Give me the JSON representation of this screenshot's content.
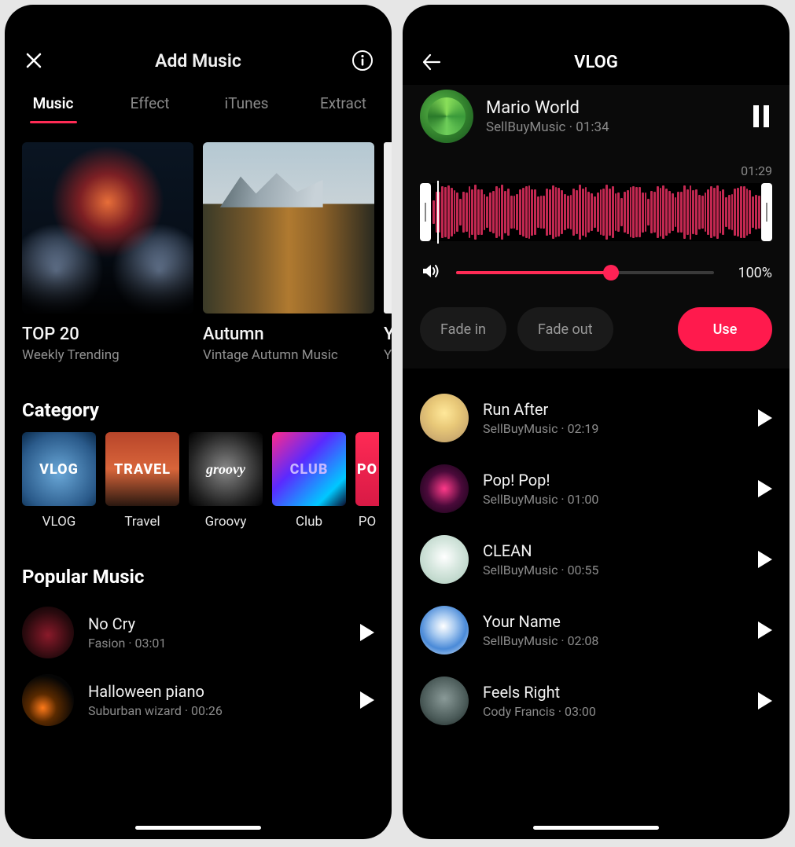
{
  "left": {
    "header": {
      "title": "Add Music"
    },
    "tabs": [
      "Music",
      "Effect",
      "iTunes",
      "Extract"
    ],
    "active_tab": 0,
    "hero": [
      {
        "title": "TOP 20",
        "subtitle": "Weekly Trending"
      },
      {
        "title": "Autumn",
        "subtitle": "Vintage Autumn Music"
      },
      {
        "title": "Y",
        "subtitle": "Y"
      }
    ],
    "category_heading": "Category",
    "categories": [
      {
        "tile": "VLOG",
        "label": "VLOG"
      },
      {
        "tile": "TRAVEL",
        "label": "Travel"
      },
      {
        "tile": "groovy",
        "label": "Groovy"
      },
      {
        "tile": "CLUB",
        "label": "Club"
      },
      {
        "tile": "PO",
        "label": "PO"
      }
    ],
    "popular_heading": "Popular Music",
    "popular": [
      {
        "title": "No Cry",
        "artist": "Fasion",
        "duration": "03:01"
      },
      {
        "title": "Halloween piano",
        "artist": "Suburban wizard",
        "duration": "00:26"
      }
    ]
  },
  "right": {
    "header": {
      "title": "VLOG"
    },
    "now_playing": {
      "title": "Mario World",
      "artist": "SellBuyMusic",
      "duration": "01:34",
      "position": "01:29",
      "volume_pct": "100%",
      "volume_fill": 60,
      "fade_in_label": "Fade in",
      "fade_out_label": "Fade out",
      "use_label": "Use"
    },
    "tracks": [
      {
        "title": "Run After",
        "artist": "SellBuyMusic",
        "duration": "02:19"
      },
      {
        "title": "Pop! Pop!",
        "artist": "SellBuyMusic",
        "duration": "01:00"
      },
      {
        "title": "CLEAN",
        "artist": "SellBuyMusic",
        "duration": "00:55"
      },
      {
        "title": "Your Name",
        "artist": "SellBuyMusic",
        "duration": "02:08"
      },
      {
        "title": "Feels Right",
        "artist": "Cody Francis",
        "duration": "03:00"
      }
    ]
  },
  "sep": "  ·  "
}
